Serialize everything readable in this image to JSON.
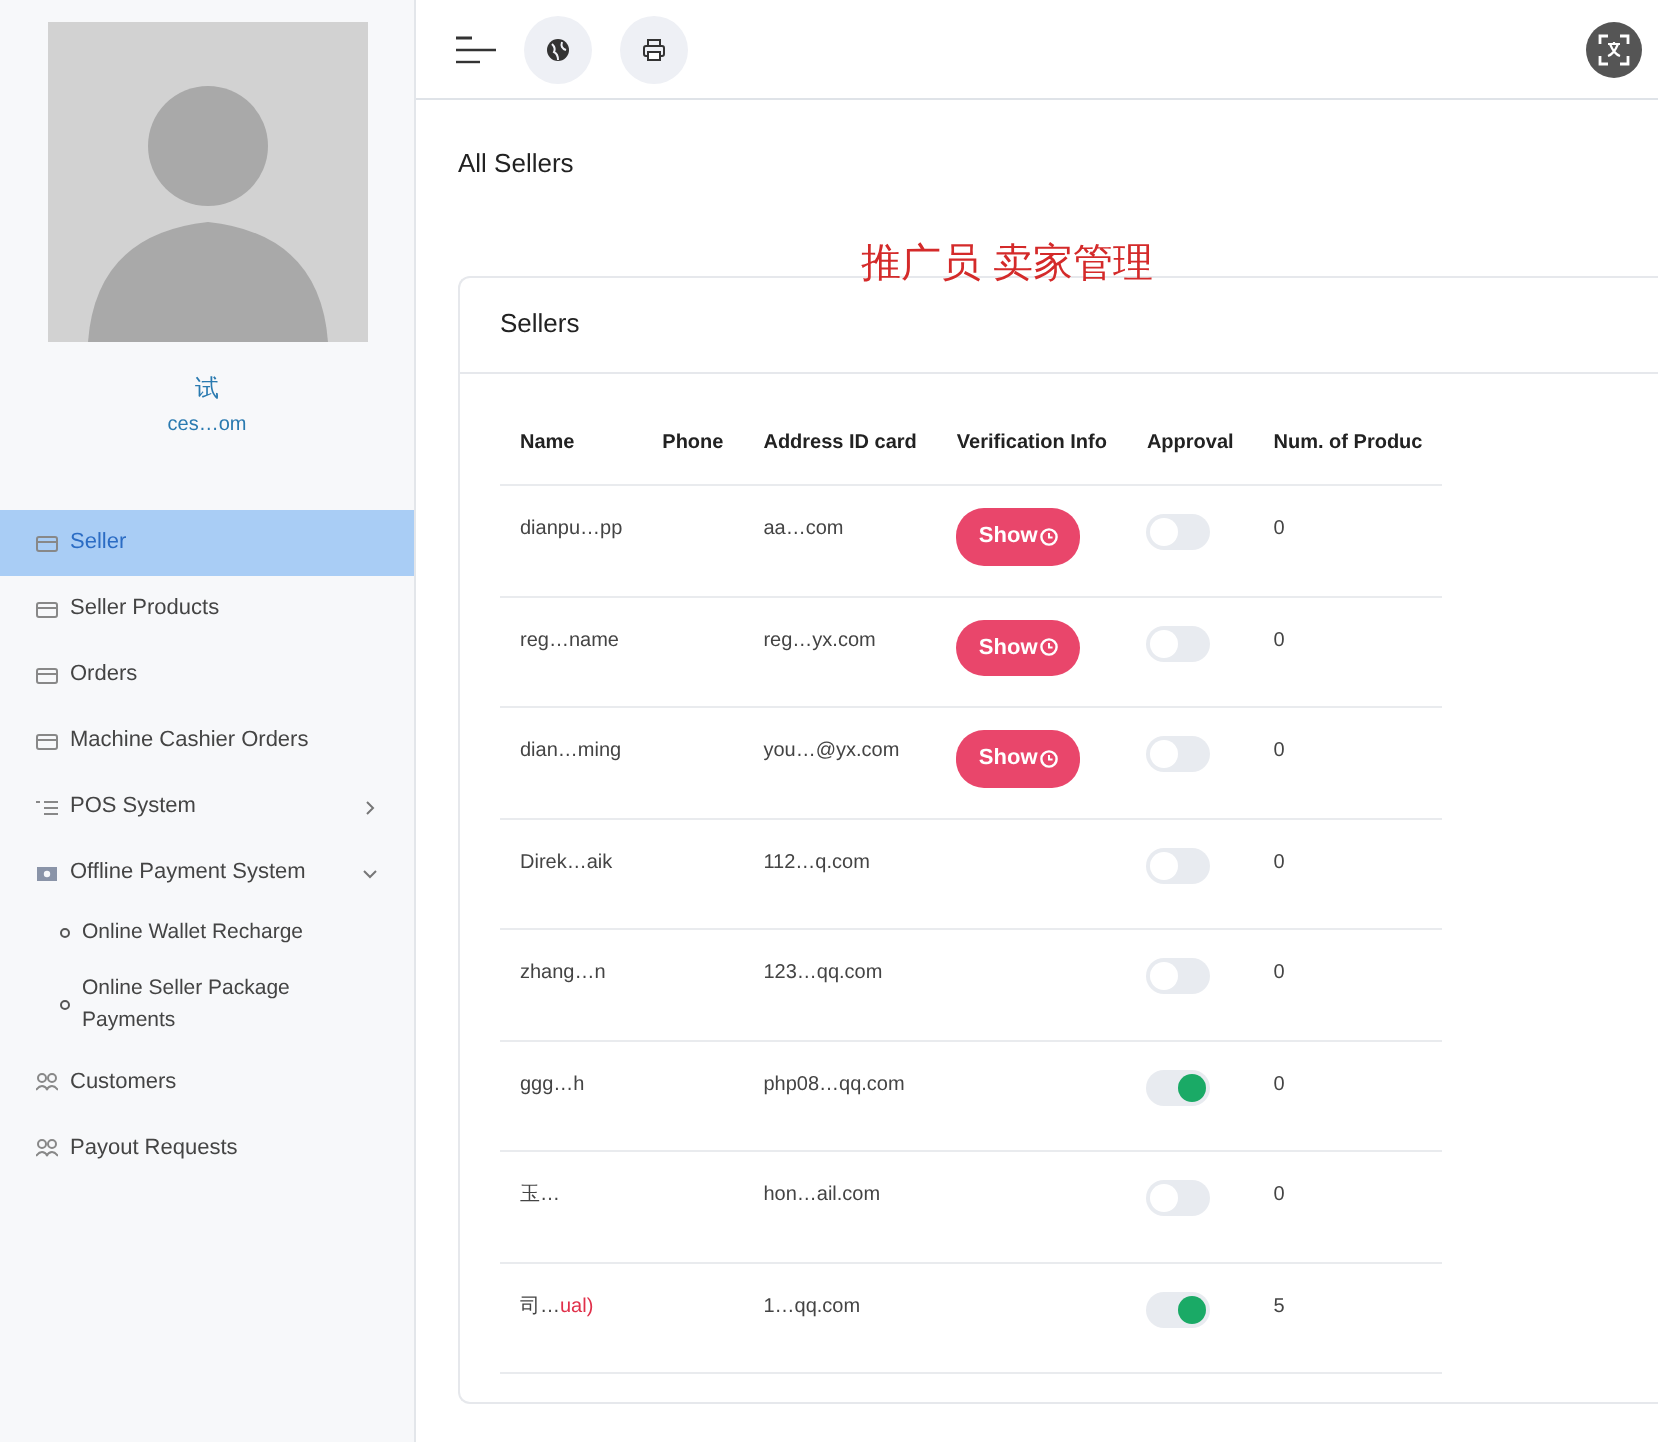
{
  "sidebar": {
    "user_name": "试",
    "user_email": "ces…om",
    "items": [
      {
        "label": "Seller",
        "kind": "card",
        "selected": true
      },
      {
        "label": "Seller Products",
        "kind": "card",
        "selected": false
      },
      {
        "label": "Orders",
        "kind": "card",
        "selected": false
      },
      {
        "label": "Machine Cashier Orders",
        "kind": "card",
        "selected": false
      },
      {
        "label": "POS System",
        "kind": "list",
        "selected": false,
        "expanded": false
      },
      {
        "label": "Offline Payment System",
        "kind": "money",
        "selected": false,
        "expanded": true,
        "children": [
          {
            "label": "Online Wallet Recharge"
          },
          {
            "label": "Online Seller Package Payments"
          }
        ]
      },
      {
        "label": "Customers",
        "kind": "users",
        "selected": false
      },
      {
        "label": "Payout Requests",
        "kind": "users",
        "selected": false
      }
    ]
  },
  "page_title": "All Sellers",
  "annotation": "推广员 卖家管理",
  "card": {
    "title": "Sellers",
    "columns": [
      "Name",
      "Phone",
      "Address ID card",
      "Verification Info",
      "Approval",
      "Num. of Produc"
    ],
    "rows": [
      {
        "name": "dianpu…pp",
        "email": "aa…com",
        "show": "Show",
        "approved": false,
        "products": "0"
      },
      {
        "name": "reg…name",
        "email": "reg…yx.com",
        "show": "Show",
        "approved": false,
        "products": "0"
      },
      {
        "name": "dian…ming",
        "email": "you…@yx.com",
        "show": "Show",
        "approved": false,
        "products": "0"
      },
      {
        "name": "Direk…aik",
        "email": "112…q.com",
        "approved": false,
        "products": "0"
      },
      {
        "name": "zhang…n",
        "email": "123…qq.com",
        "approved": false,
        "products": "0"
      },
      {
        "name": "ggg…h",
        "email": "php08…qq.com",
        "approved": true,
        "products": "0"
      },
      {
        "name": "玉…",
        "email": "hon…ail.com",
        "approved": false,
        "products": "0"
      },
      {
        "name": "司…",
        "note": "ual)",
        "email": "1…qq.com",
        "approved": true,
        "products": "5"
      }
    ]
  }
}
